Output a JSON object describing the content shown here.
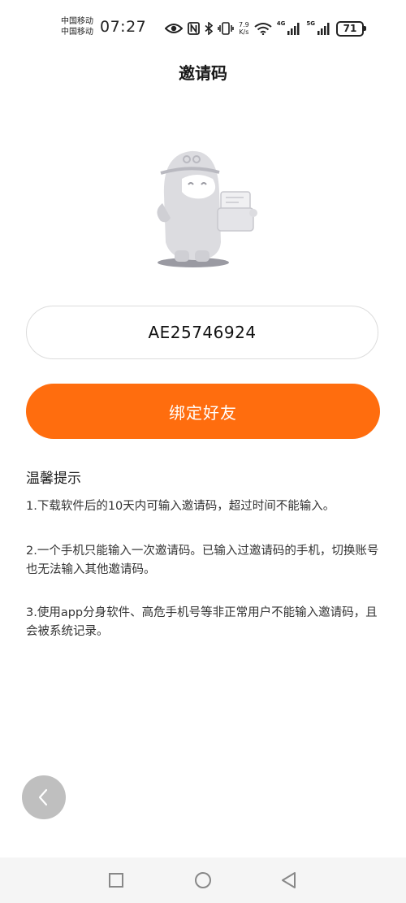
{
  "status_bar": {
    "carrier_1": "中国移动",
    "carrier_2": "中国移动",
    "time": "07:27",
    "net_speed_value": "7.9",
    "net_speed_unit": "K/s",
    "signal_1_label": "4G",
    "signal_2_label": "5G",
    "battery": "71"
  },
  "header": {
    "title": "邀请码"
  },
  "invite": {
    "code": "AE25746924"
  },
  "bind_button": {
    "label": "绑定好友"
  },
  "tips": {
    "heading": "温馨提示",
    "items": [
      "1.下载软件后的10天内可输入邀请码，超过时间不能输入。",
      "2.一个手机只能输入一次邀请码。已输入过邀请码的手机，切换账号也无法输入其他邀请码。",
      "3.使用app分身软件、高危手机号等非正常用户不能输入邀请码，且会被系统记录。"
    ]
  },
  "colors": {
    "accent": "#ff6d0e",
    "fab": "#bfbfbf",
    "nav_bg": "#f5f5f5"
  },
  "icons": {
    "status": [
      "eye-icon",
      "nfc-icon",
      "bluetooth-icon",
      "vibrate-icon",
      "wifi-icon",
      "signal-icon",
      "battery-icon"
    ],
    "nav": [
      "square-icon",
      "circle-icon",
      "triangle-back-icon"
    ],
    "back": "chevron-left-icon"
  }
}
